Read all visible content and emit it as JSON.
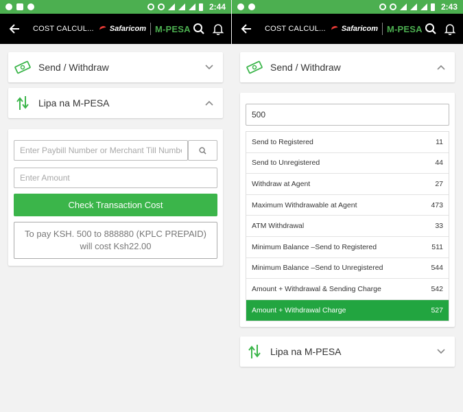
{
  "left": {
    "status_time": "2:44",
    "appbar": {
      "title": "COST CALCUL...",
      "brand_safaricom": "Safaricom",
      "brand_mpesa": "M-PESA"
    },
    "send_withdraw": {
      "label": "Send / Withdraw",
      "expanded": false
    },
    "lipa": {
      "label": "Lipa na M-PESA",
      "expanded": true,
      "paybill_placeholder": "Enter Paybill Number or Merchant Till Number",
      "amount_placeholder": "Enter Amount",
      "check_button": "Check Transaction Cost",
      "result_line1": "To pay KSH. 500 to 888880 (KPLC PREPAID)",
      "result_line2": "will cost Ksh22.00"
    }
  },
  "right": {
    "status_time": "2:43",
    "appbar": {
      "title": "COST CALCUL...",
      "brand_safaricom": "Safaricom",
      "brand_mpesa": "M-PESA"
    },
    "send_withdraw": {
      "label": "Send / Withdraw",
      "expanded": true,
      "amount_value": "500",
      "rows": [
        {
          "label": "Send to Registered",
          "value": "11"
        },
        {
          "label": "Send to Unregistered",
          "value": "44"
        },
        {
          "label": "Withdraw at Agent",
          "value": "27"
        },
        {
          "label": "Maximum Withdrawable at Agent",
          "value": "473"
        },
        {
          "label": "ATM Withdrawal",
          "value": "33"
        },
        {
          "label": "Minimum Balance –Send to Registered",
          "value": "511"
        },
        {
          "label": "Minimum Balance –Send to Unregistered",
          "value": "544"
        },
        {
          "label": "Amount + Withdrawal & Sending Charge",
          "value": "542"
        },
        {
          "label": "Amount + Withdrawal Charge",
          "value": "527"
        }
      ]
    },
    "lipa": {
      "label": "Lipa na M-PESA",
      "expanded": false
    }
  },
  "colors": {
    "status_green": "#4caf50",
    "accent_green": "#3bb54a",
    "highlight_green": "#22a540",
    "appbar_black": "#000000",
    "safaricom_red": "#e53935"
  }
}
